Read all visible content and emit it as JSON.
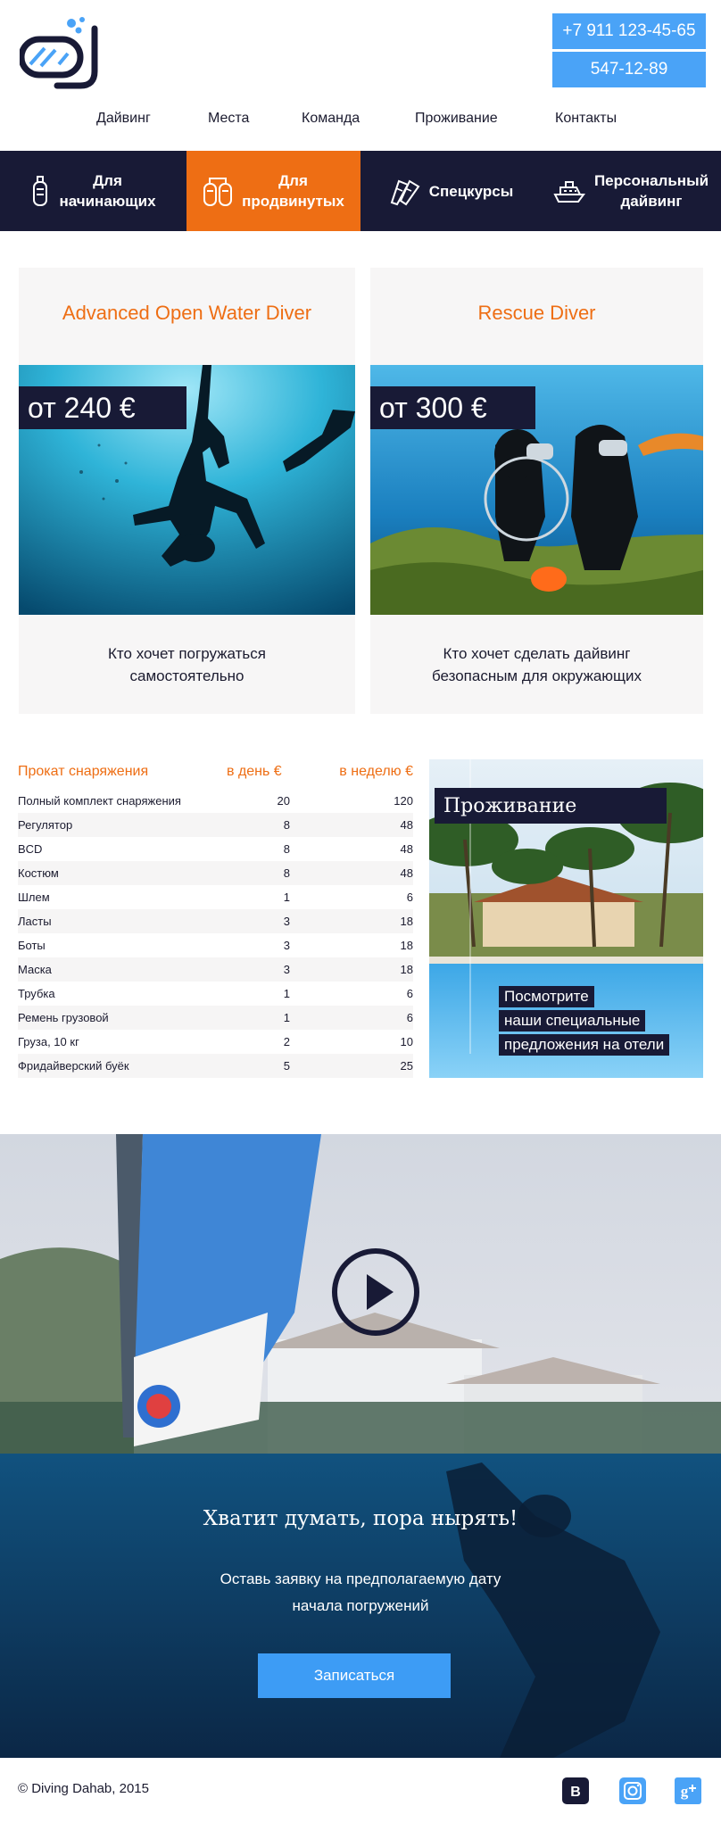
{
  "header": {
    "phones": [
      "+7 911 123-45-65",
      "547-12-89"
    ]
  },
  "nav": [
    "Дайвинг",
    "Места",
    "Команда",
    "Проживание",
    "Контакты"
  ],
  "categories": [
    {
      "label": "Для\nначинающих",
      "icon": "scuba-tank-icon",
      "active": false
    },
    {
      "label": "Для\nпродвинутых",
      "icon": "double-tank-icon",
      "active": true
    },
    {
      "label": "Спецкурсы",
      "icon": "fins-icon",
      "active": false
    },
    {
      "label": "Персональный\nдайвинг",
      "icon": "boat-icon",
      "active": false
    }
  ],
  "courses": [
    {
      "title": "Advanced Open Water Diver",
      "price": "от 240 €",
      "desc": "Кто хочет погружаться\nсамостоятельно"
    },
    {
      "title": "Rescue Diver",
      "price": "от 300 €",
      "desc": "Кто хочет сделать дайвинг\nбезопасным для окружающих"
    }
  ],
  "rental": {
    "headers": [
      "Прокат снаряжения",
      "в день €",
      "в неделю €"
    ],
    "rows": [
      [
        "Полный комплект снаряжения",
        "20",
        "120"
      ],
      [
        "Регулятор",
        "8",
        "48"
      ],
      [
        "BCD",
        "8",
        "48"
      ],
      [
        "Костюм",
        "8",
        "48"
      ],
      [
        "Шлем",
        "1",
        "6"
      ],
      [
        "Ласты",
        "3",
        "18"
      ],
      [
        "Боты",
        "3",
        "18"
      ],
      [
        "Маска",
        "3",
        "18"
      ],
      [
        "Трубка",
        "1",
        "6"
      ],
      [
        "Ремень грузовой",
        "1",
        "6"
      ],
      [
        "Груза, 10 кг",
        "2",
        "10"
      ],
      [
        "Фридайверский буёк",
        "5",
        "25"
      ]
    ]
  },
  "accommodation": {
    "title": "Проживание",
    "lines": [
      "Посмотрите",
      "наши специальные",
      "предложения на отели"
    ]
  },
  "cta": {
    "title": "Хватит думать, пора нырять!",
    "subtitle": "Оставь заявку на предполагаемую дату\nначала погружений",
    "button": "Записаться"
  },
  "footer": {
    "copyright": "© Diving Dahab, 2015",
    "social": [
      "vk-icon",
      "instagram-icon",
      "google-plus-icon"
    ]
  },
  "colors": {
    "navy": "#181a36",
    "orange": "#ee6e14",
    "blue": "#4aa3f7"
  }
}
